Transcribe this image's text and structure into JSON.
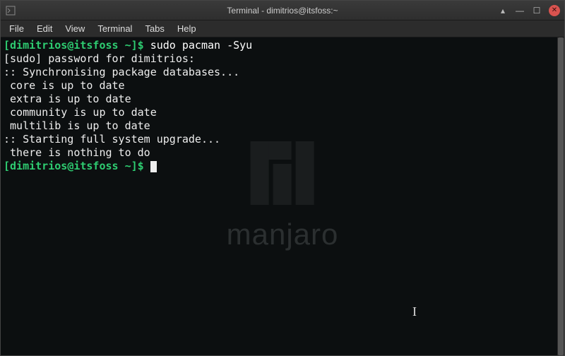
{
  "window": {
    "title": "Terminal - dimitrios@itsfoss:~"
  },
  "menubar": {
    "items": [
      "File",
      "Edit",
      "View",
      "Terminal",
      "Tabs",
      "Help"
    ]
  },
  "prompt": {
    "user": "dimitrios",
    "host": "itsfoss",
    "path": "~",
    "symbol": "$"
  },
  "session": {
    "command": "sudo pacman -Syu",
    "lines": [
      "[sudo] password for dimitrios:",
      ":: Synchronising package databases...",
      " core is up to date",
      " extra is up to date",
      " community is up to date",
      " multilib is up to date",
      ":: Starting full system upgrade...",
      " there is nothing to do"
    ]
  },
  "branding": {
    "text": "manjaro"
  }
}
